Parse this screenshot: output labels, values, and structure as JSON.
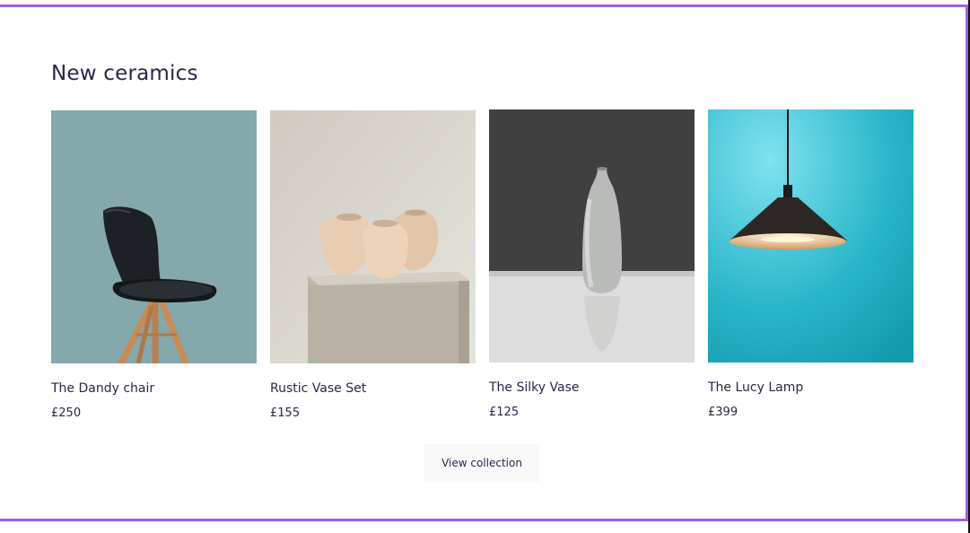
{
  "section": {
    "title": "New ceramics"
  },
  "products": [
    {
      "name": "The Dandy chair",
      "price": "£250",
      "image": "chair-image"
    },
    {
      "name": "Rustic Vase Set",
      "price": "£155",
      "image": "vase-set-image"
    },
    {
      "name": "The Silky Vase",
      "price": "£125",
      "image": "silky-vase-image"
    },
    {
      "name": "The Lucy Lamp",
      "price": "£399",
      "image": "lamp-image"
    }
  ],
  "cta": {
    "label": "View collection"
  },
  "colors": {
    "accent_border": "#9b5ef0",
    "text": "#2a254b",
    "button_bg": "#f9f9f9"
  }
}
